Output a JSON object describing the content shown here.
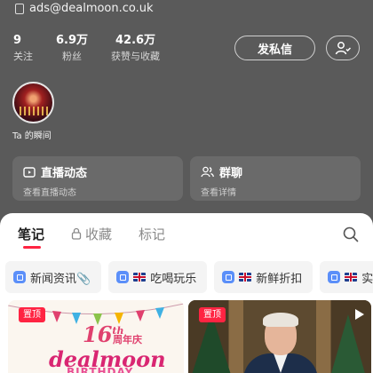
{
  "profile": {
    "email": "ads@dealmoon.co.uk",
    "stats": [
      {
        "value": "9",
        "label": "关注"
      },
      {
        "value": "6.9万",
        "label": "粉丝"
      },
      {
        "value": "42.6万",
        "label": "获赞与收藏"
      }
    ],
    "message_button": "发私信",
    "moments_label": "Ta 的瞬间"
  },
  "cards": {
    "live": {
      "title": "直播动态",
      "subtitle": "查看直播动态"
    },
    "group": {
      "title": "群聊",
      "subtitle": "查看详情"
    }
  },
  "tabs": [
    {
      "label": "笔记",
      "active": true
    },
    {
      "label": "收藏",
      "active": false,
      "locked": true
    },
    {
      "label": "标记",
      "active": false
    }
  ],
  "chips": [
    {
      "label": "新闻资讯📎",
      "flag": false
    },
    {
      "label": "吃喝玩乐",
      "flag": true
    },
    {
      "label": "新鲜折扣",
      "flag": true
    },
    {
      "label": "实",
      "flag": true
    }
  ],
  "posts": [
    {
      "pin_label": "置顶",
      "art": {
        "number": "16",
        "ordinal": "th",
        "anniversary": "周年庆",
        "brand": "dealmoon",
        "banner": "BIRTHDAY"
      }
    },
    {
      "pin_label": "置顶",
      "type": "video"
    }
  ],
  "colors": {
    "accent": "#ff2442",
    "header_bg": "#5a5a5a"
  },
  "icons": [
    "badge-icon",
    "add-friend-icon",
    "tv-icon",
    "group-icon",
    "lock-icon",
    "search-icon",
    "note-icon",
    "uk-flag-icon",
    "play-icon"
  ]
}
